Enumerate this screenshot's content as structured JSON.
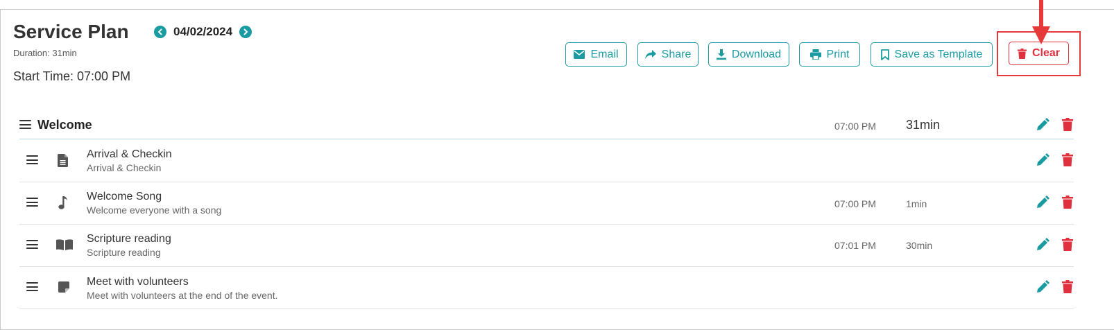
{
  "header": {
    "title": "Service Plan",
    "date": "04/02/2024",
    "duration": "Duration: 31min",
    "start_time": "Start Time: 07:00 PM"
  },
  "toolbar": {
    "email_label": "Email",
    "share_label": "Share",
    "download_label": "Download",
    "print_label": "Print",
    "template_label": "Save as Template",
    "clear_label": "Clear"
  },
  "section": {
    "title": "Welcome",
    "time": "07:00 PM",
    "duration": "31min"
  },
  "items": [
    {
      "icon": "file-icon",
      "title": "Arrival & Checkin",
      "subtitle": "Arrival & Checkin",
      "time": "",
      "duration": ""
    },
    {
      "icon": "music-note-icon",
      "title": "Welcome Song",
      "subtitle": "Welcome everyone with a song",
      "time": "07:00 PM",
      "duration": "1min"
    },
    {
      "icon": "book-icon",
      "title": "Scripture reading",
      "subtitle": "Scripture reading",
      "time": "07:01 PM",
      "duration": "30min"
    },
    {
      "icon": "sticky-note-icon",
      "title": "Meet with volunteers",
      "subtitle": "Meet with volunteers at the end of the event.",
      "time": "",
      "duration": ""
    }
  ],
  "colors": {
    "accent": "#1a9ba1",
    "danger": "#e0303e",
    "annotation": "#e63a3a"
  }
}
